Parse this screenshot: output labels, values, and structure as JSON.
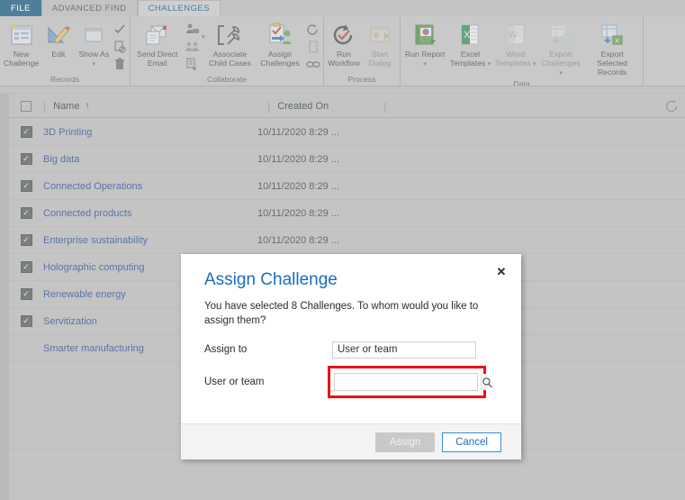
{
  "tabs": [
    {
      "id": "file",
      "label": "FILE"
    },
    {
      "id": "advanced-find",
      "label": "ADVANCED FIND"
    },
    {
      "id": "challenges",
      "label": "CHALLENGES"
    }
  ],
  "ribbon": {
    "groups": [
      {
        "label": "Records",
        "commands": [
          {
            "name": "new-challenge",
            "label": "New Challenge",
            "icon": "new-record-icon",
            "dim": false
          },
          {
            "name": "edit",
            "label": "Edit",
            "icon": "edit-pencil-ruler-icon",
            "dim": false
          },
          {
            "name": "show-as",
            "label": "Show As",
            "icon": "show-as-icon",
            "dim": false,
            "caret": true
          }
        ],
        "mini": [
          {
            "name": "activate-checkmark-icon",
            "glyph": "check",
            "faint": false
          },
          {
            "name": "deactivate-icon",
            "glyph": "doc-ban",
            "faint": false
          },
          {
            "name": "delete-trash-icon",
            "glyph": "trash",
            "faint": false
          }
        ]
      },
      {
        "label": "Collaborate",
        "commands": [
          {
            "name": "send-direct-email",
            "label": "Send Direct Email",
            "icon": "email-envelope-icon",
            "dim": false
          },
          {
            "name": "associate-child-cases",
            "label": "Associate Child Cases",
            "icon": "wrench-bracket-icon",
            "dim": false
          },
          {
            "name": "assign-challenges",
            "label": "Assign Challenges",
            "icon": "assign-clipboard-user-icon",
            "dim": false
          }
        ],
        "mini": [
          {
            "name": "add-connection-icon",
            "glyph": "person-mail",
            "faint": false
          },
          {
            "name": "connect-to-icon",
            "glyph": "people",
            "faint": true
          },
          {
            "name": "add-to-queue-icon",
            "glyph": "queue-plus",
            "faint": false
          }
        ],
        "mini2": [
          {
            "name": "run-workflow-circular-icon",
            "glyph": "cycle",
            "faint": false
          },
          {
            "name": "document-icon",
            "glyph": "doc",
            "faint": true
          },
          {
            "name": "link-chain-icon",
            "glyph": "link",
            "faint": false
          }
        ]
      },
      {
        "label": "Process",
        "commands": [
          {
            "name": "run-workflow",
            "label": "Run Workflow",
            "icon": "run-workflow-icon",
            "dim": false
          },
          {
            "name": "start-dialog",
            "label": "Start Dialog",
            "icon": "start-dialog-icon",
            "dim": true
          }
        ]
      },
      {
        "label": "Data",
        "commands": [
          {
            "name": "run-report",
            "label": "Run Report",
            "icon": "run-report-icon",
            "dim": false,
            "caret": true
          },
          {
            "name": "excel-templates",
            "label": "Excel Templates",
            "icon": "excel-icon",
            "dim": false,
            "caret": true
          },
          {
            "name": "word-templates",
            "label": "Word Templates",
            "icon": "word-icon",
            "dim": true,
            "caret": true
          },
          {
            "name": "export-challenges",
            "label": "Export Challenges",
            "icon": "export-excel-icon",
            "dim": true,
            "caret": true
          },
          {
            "name": "export-selected-records",
            "label": "Export Selected Records",
            "icon": "export-selected-icon",
            "dim": false
          }
        ]
      }
    ]
  },
  "grid": {
    "columns": [
      {
        "key": "name",
        "label": "Name",
        "sorted": true,
        "sort_arrow": "↑"
      },
      {
        "key": "created_on",
        "label": "Created On",
        "sorted": false,
        "sort_arrow": ""
      }
    ],
    "select_all_checked": false,
    "refresh_icon": "refresh-icon",
    "rows": [
      {
        "selected": true,
        "name": "3D Printing",
        "created_on": "10/11/2020 8:29 ..."
      },
      {
        "selected": true,
        "name": "Big data",
        "created_on": "10/11/2020 8:29 ..."
      },
      {
        "selected": true,
        "name": "Connected Operations",
        "created_on": "10/11/2020 8:29 ..."
      },
      {
        "selected": true,
        "name": "Connected products",
        "created_on": "10/11/2020 8:29 ..."
      },
      {
        "selected": true,
        "name": "Enterprise sustainability",
        "created_on": "10/11/2020 8:29 ..."
      },
      {
        "selected": true,
        "name": "Holographic computing",
        "created_on": ""
      },
      {
        "selected": true,
        "name": "Renewable energy",
        "created_on": ""
      },
      {
        "selected": true,
        "name": "Servitization",
        "created_on": ""
      },
      {
        "selected": false,
        "name": "Smarter manufacturing",
        "created_on": ""
      }
    ]
  },
  "dialog": {
    "title": "Assign Challenge",
    "close_label": "✕",
    "description": "You have selected 8 Challenges. To whom would you like to assign them?",
    "fields": [
      {
        "name": "assign-to",
        "label": "Assign to",
        "value": "User or team",
        "type": "select"
      },
      {
        "name": "user-or-team",
        "label": "User or team",
        "value": "",
        "placeholder": "",
        "type": "lookup",
        "highlighted": true,
        "search_icon": "search-icon"
      }
    ],
    "buttons": [
      {
        "name": "assign-button",
        "label": "Assign",
        "style": "primary-disabled"
      },
      {
        "name": "cancel-button",
        "label": "Cancel",
        "style": "secondary"
      }
    ]
  },
  "colors": {
    "accent_blue": "#1a6cc4",
    "file_tab_blue": "#4f7e9b",
    "highlight_red": "#ee1111",
    "app_gray": "#c4c4c4",
    "link_blue": "#5b74a8"
  }
}
